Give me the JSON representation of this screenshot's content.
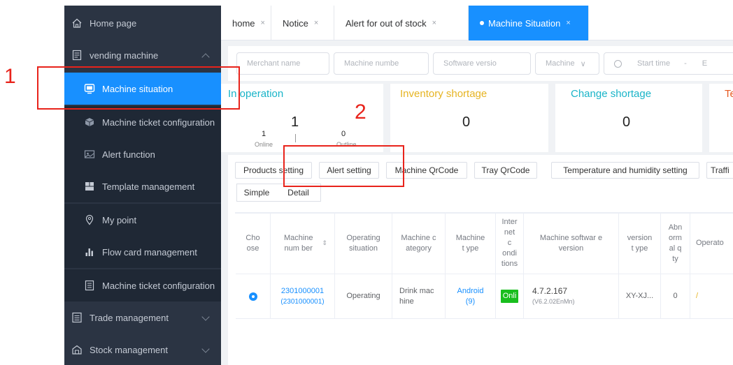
{
  "sidebar": {
    "items": [
      {
        "label": "Home page",
        "icon": "home-icon"
      },
      {
        "label": "vending machine",
        "icon": "vending-machine-icon"
      },
      {
        "label": "Machine situation",
        "icon": "monitor-icon"
      },
      {
        "label": "Machine ticket configuration",
        "icon": "ticket-config-icon"
      },
      {
        "label": "Alert function",
        "icon": "alert-icon"
      },
      {
        "label": "Template management",
        "icon": "template-icon"
      },
      {
        "label": "My point",
        "icon": "location-pin-icon"
      },
      {
        "label": "Flow card management",
        "icon": "bar-chart-icon"
      },
      {
        "label": "Machine ticket configuration",
        "icon": "ticket-list-icon"
      },
      {
        "label": "Trade management",
        "icon": "trade-icon"
      },
      {
        "label": "Stock management",
        "icon": "stock-icon"
      }
    ]
  },
  "tabs": [
    {
      "label": "home",
      "close": "×"
    },
    {
      "label": "Notice",
      "close": "×"
    },
    {
      "label": "Alert for out of stock",
      "close": "×"
    },
    {
      "label": "Machine Situation",
      "close": "×"
    }
  ],
  "filters": {
    "merchant": "Merchant name",
    "machine_number": "Machine numbe",
    "software_version": "Software versio",
    "machine_select": "Machine",
    "start_time": "Start time",
    "separator": "-",
    "end_cut": "E"
  },
  "cards": {
    "in_operation": {
      "title": "In operation",
      "total": "1",
      "online": "1",
      "online_label": "Online",
      "offline": "0",
      "offline_label": "Outline"
    },
    "inventory_shortage": {
      "title": "Inventory shortage",
      "value": "0"
    },
    "change_shortage": {
      "title": "Change shortage",
      "value": "0"
    },
    "fourth": {
      "title": "Te"
    }
  },
  "buttons": {
    "products_setting": "Products setting",
    "alert_setting": "Alert setting",
    "machine_qrcode": "Machine QrCode",
    "tray_qrcode": "Tray QrCode",
    "temp_humidity": "Temperature and humidity setting",
    "traffic": "Traffi",
    "simple": "Simple",
    "detail": "Detail"
  },
  "table": {
    "headers": {
      "choose": "Cho ose",
      "machine_number": "Machine num ber",
      "operating": "Operating situation",
      "category": "Machine c ategory",
      "type": "Machine t ype",
      "internet": "Inter net c ondi tions",
      "software": "Machine softwar e version",
      "version_type": "version t ype",
      "abnormal": "Abn orm al q ty",
      "operator": "Operato"
    },
    "row": {
      "machine_number": "2301000001",
      "machine_number_sub": "(2301000001)",
      "operating": "Operating",
      "category": "Drink mac hine",
      "type": "Android",
      "type_sub": "(9)",
      "internet": "Onli",
      "software": "4.7.2.167",
      "software_sub": "(V6.2.02EnMn)",
      "version_type": "XY-XJ...",
      "abnormal": "0",
      "operator": "/"
    }
  },
  "annotations": {
    "one": "1",
    "two": "2"
  },
  "colors": {
    "sidebar_bg": "#2b3443",
    "accent": "#1890ff",
    "in_operation": "#19b4c8",
    "inventory": "#e6b422",
    "change": "#19b4c8",
    "fourth": "#e65a22",
    "annotation": "#e8231b",
    "online_badge": "#19be1e"
  }
}
